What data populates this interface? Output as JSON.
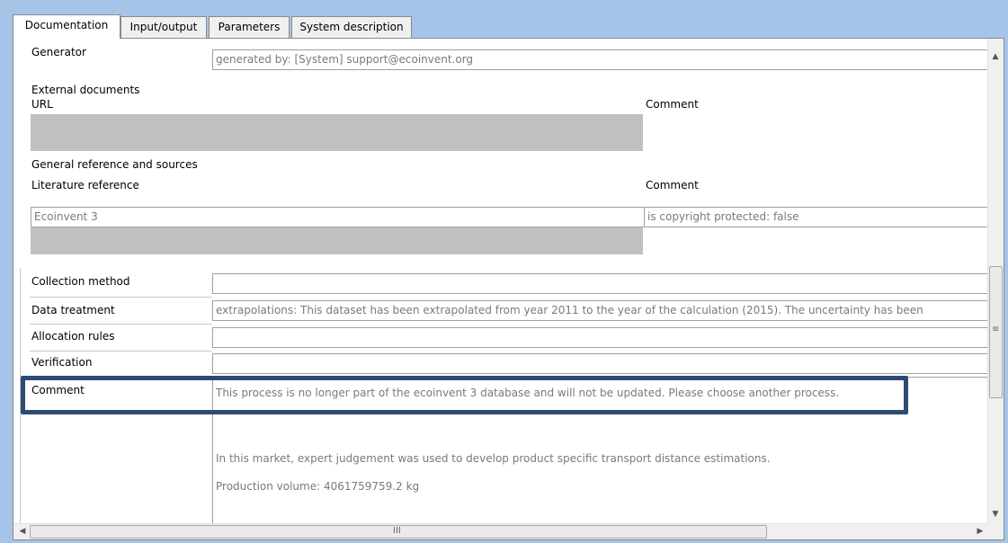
{
  "tabs": [
    "Documentation",
    "Input/output",
    "Parameters",
    "System description"
  ],
  "generator": {
    "label": "Generator",
    "value": "generated by: [System] support@ecoinvent.org"
  },
  "external_documents": {
    "heading": "External documents",
    "url_header": "URL",
    "comment_header": "Comment"
  },
  "general_reference": {
    "heading": "General reference and sources",
    "literature_header": "Literature reference",
    "comment_header": "Comment",
    "literature_value": "Ecoinvent 3",
    "comment_value": "is copyright protected: false"
  },
  "collection_method": {
    "label": "Collection method",
    "value": ""
  },
  "data_treatment": {
    "label": "Data treatment",
    "value": "extrapolations: This dataset has been extrapolated from year 2011 to the year of the calculation (2015). The uncertainty has been"
  },
  "allocation_rules": {
    "label": "Allocation rules",
    "value": ""
  },
  "verification": {
    "label": "Verification",
    "value": ""
  },
  "comment": {
    "label": "Comment",
    "line1": "This process is no longer part of the ecoinvent 3 database and will not be updated. Please choose another process.",
    "line2": "In this market, expert judgement was used to develop product specific transport distance estimations.",
    "line3": "Production volume: 4061759759.2 kg"
  },
  "scrollbar": {
    "up": "▲",
    "down": "▼",
    "left": "◀",
    "right": "▶",
    "grip_v": "≡",
    "grip_h": "III"
  },
  "colors": {
    "highlight_border": "#2c4a74",
    "window_background": "#a6c4e8"
  }
}
